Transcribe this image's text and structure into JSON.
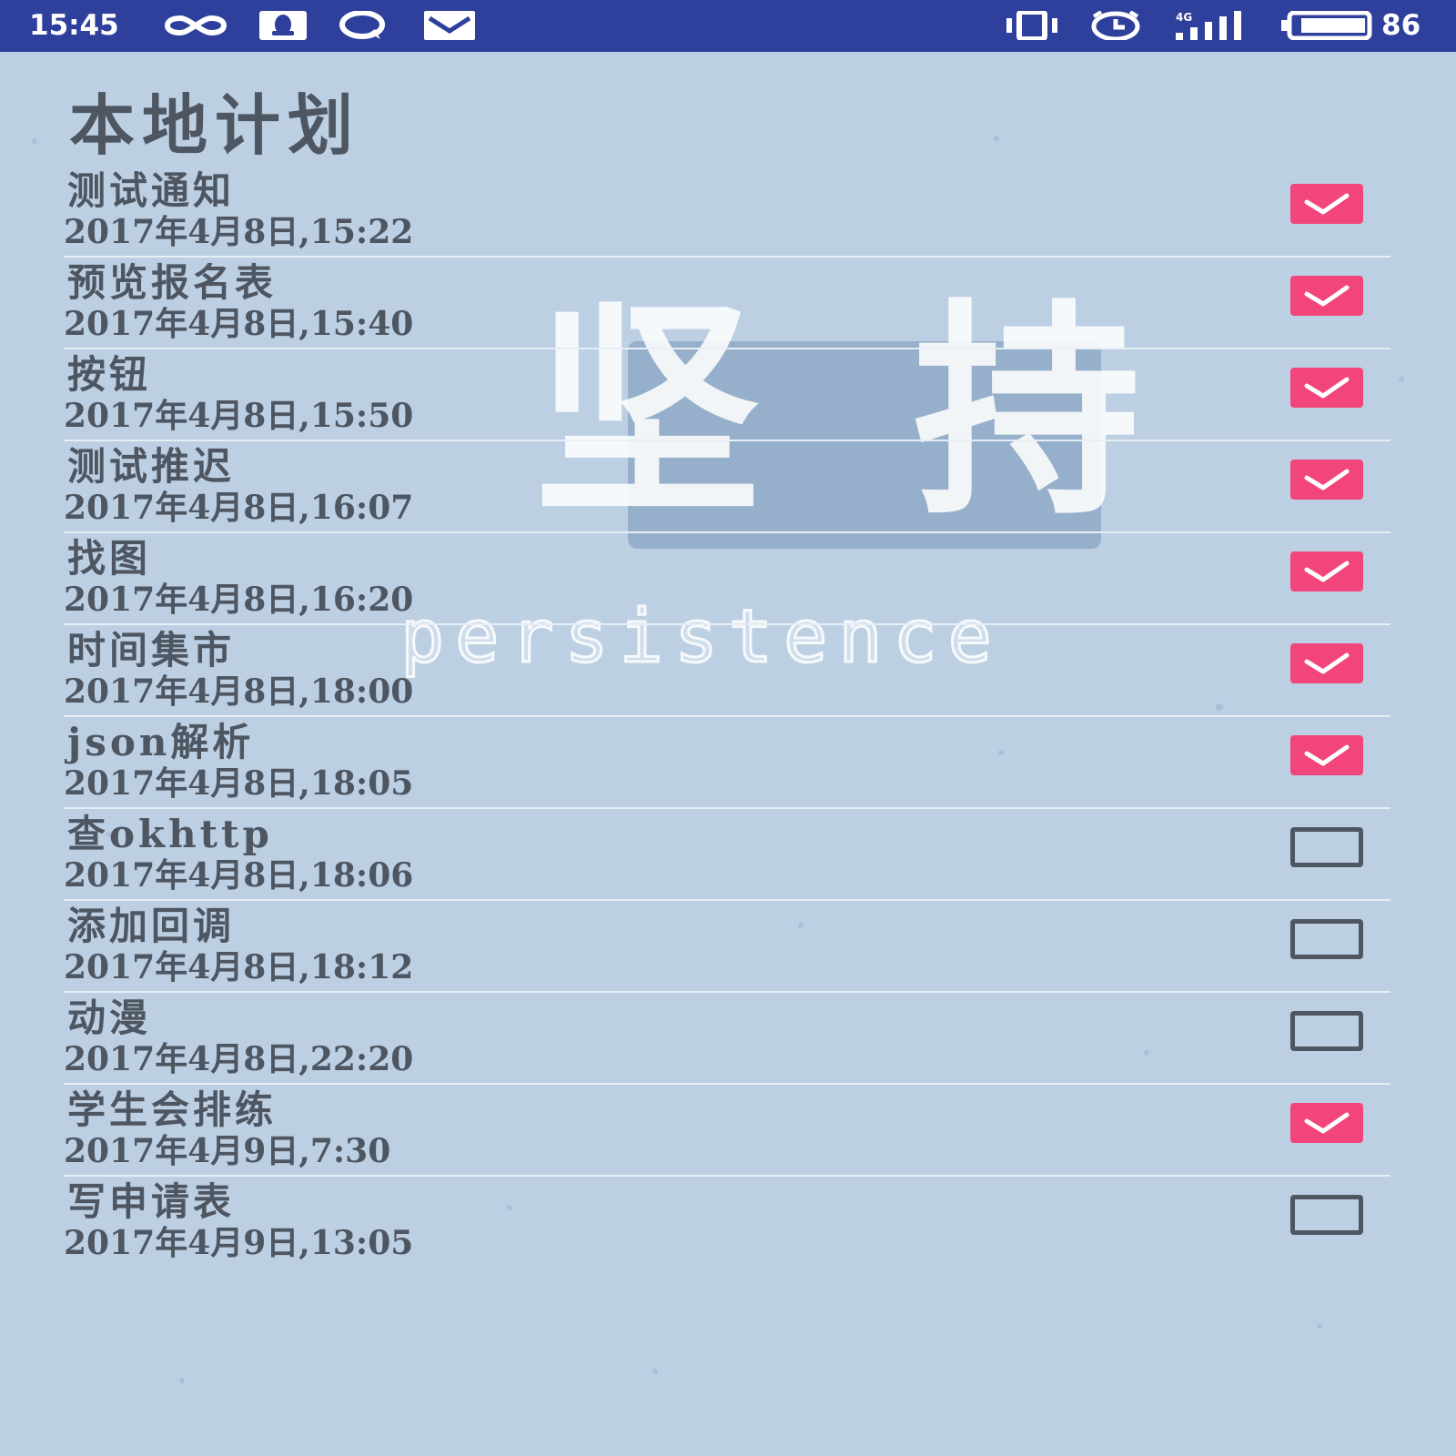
{
  "status_bar": {
    "time": "15:45",
    "battery": "86",
    "icons": [
      "infinity-icon",
      "qq-icon",
      "chat-icon",
      "mail-icon",
      "vibrate-icon",
      "alarm-icon",
      "signal-4g-icon",
      "battery-icon"
    ],
    "network_label": "4G"
  },
  "background": {
    "big_text": "坚 持",
    "small_text": "persistence"
  },
  "page": {
    "title": "本地计划"
  },
  "colors": {
    "status_bar": "#2e3f9c",
    "background": "#bccfe3",
    "text": "#4e5661",
    "checked": "#f2457b"
  },
  "plans": [
    {
      "name": "测试通知",
      "time": "2017年4月8日,15:22",
      "checked": true
    },
    {
      "name": "预览报名表",
      "time": "2017年4月8日,15:40",
      "checked": true
    },
    {
      "name": "按钮",
      "time": "2017年4月8日,15:50",
      "checked": true
    },
    {
      "name": "测试推迟",
      "time": "2017年4月8日,16:07",
      "checked": true
    },
    {
      "name": "找图",
      "time": "2017年4月8日,16:20",
      "checked": true
    },
    {
      "name": "时间集市",
      "time": "2017年4月8日,18:00",
      "checked": true
    },
    {
      "name": "json解析",
      "time": "2017年4月8日,18:05",
      "checked": true
    },
    {
      "name": "查okhttp",
      "time": "2017年4月8日,18:06",
      "checked": false
    },
    {
      "name": "添加回调",
      "time": "2017年4月8日,18:12",
      "checked": false
    },
    {
      "name": "动漫",
      "time": "2017年4月8日,22:20",
      "checked": false
    },
    {
      "name": "学生会排练",
      "time": "2017年4月9日,7:30",
      "checked": true
    },
    {
      "name": "写申请表",
      "time": "2017年4月9日,13:05",
      "checked": false
    }
  ]
}
